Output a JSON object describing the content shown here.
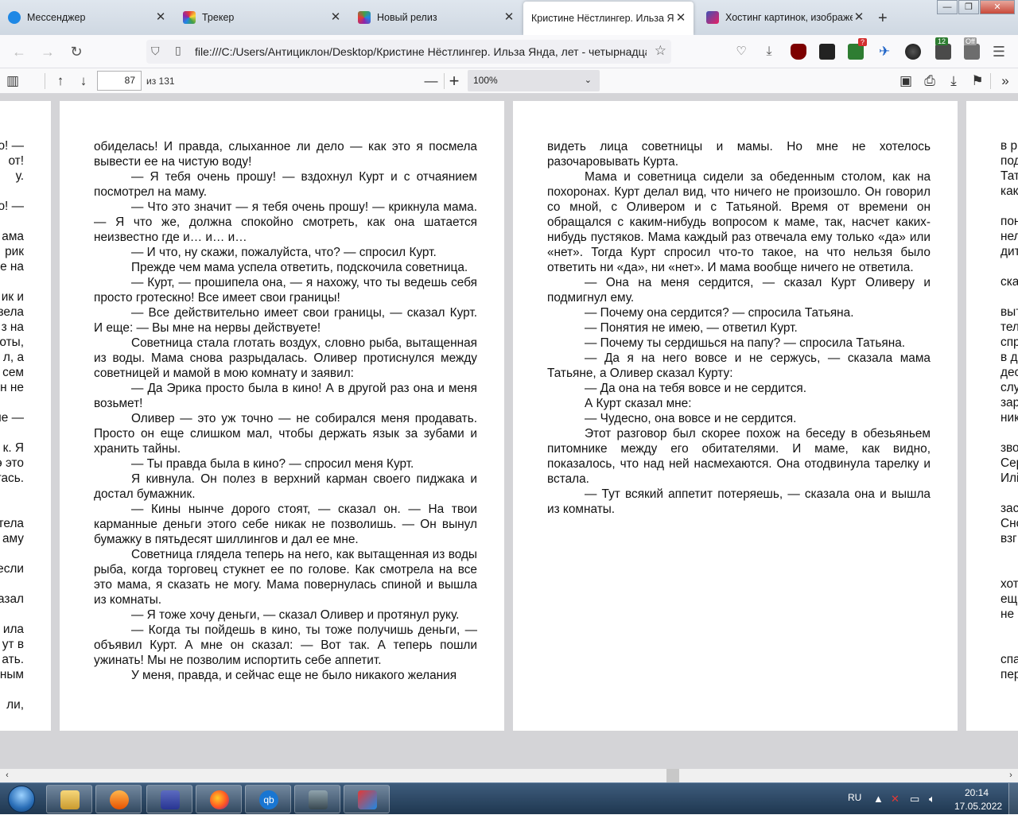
{
  "tabs": [
    {
      "label": "Мессенджер",
      "color": "#1e88e5",
      "active": false
    },
    {
      "label": "Трекер",
      "color": "#c2185b",
      "active": false
    },
    {
      "label": "Новый релиз",
      "color": "#8e24aa",
      "active": false
    },
    {
      "label": "Кристине Нёстлингер. Ильза Янда",
      "color": "",
      "active": true
    },
    {
      "label": "Хостинг картинок, изображе",
      "color": "#3f51b5",
      "active": false
    }
  ],
  "nav": {
    "url": "file:///C:/Users/Антициклон/Desktop/Кристине Нёстлингер. Ильза Янда, лет - четырнадцать"
  },
  "extensions": {
    "badge_1": "?",
    "badge_2": "12",
    "badge_3": "Off"
  },
  "pdf_toolbar": {
    "page_number": "87",
    "page_total": "из 131",
    "zoom": "100%"
  },
  "left_edge_lines": [
    "о! —",
    "от!",
    "у.",
    "",
    "о! —",
    "",
    "ама",
    "рик",
    "е на",
    "",
    "ик и",
    "зела",
    "з на",
    "оты,",
    "л, а",
    "сем",
    "н не",
    "",
    "не —",
    "",
    "к. Я",
    "э это",
    "тась.",
    "",
    "",
    "тела",
    "аму",
    "",
    "если",
    "",
    "азал",
    "",
    "ила",
    "ут в",
    "ать.",
    "ным",
    "",
    "ли,"
  ],
  "page_left": [
    {
      "indent": false,
      "text": "обиделась! И правда, слыханное ли дело — как это я посмела вывести ее на чистую воду!"
    },
    {
      "indent": true,
      "text": "— Я тебя очень прошу! — вздохнул Курт и с отчаянием посмотрел на маму."
    },
    {
      "indent": true,
      "text": "— Что это значит — я тебя очень прошу! — крикнула мама. — Я что же, должна спокойно смотреть, как она шатается неизвестно где и… и… и…"
    },
    {
      "indent": true,
      "text": "— И что, ну скажи, пожалуйста, что? — спросил Курт."
    },
    {
      "indent": true,
      "text": "Прежде чем мама успела ответить, подскочила советница."
    },
    {
      "indent": true,
      "text": "— Курт, — прошипела она, — я нахожу, что ты ведешь себя просто гротескно! Все имеет свои границы!"
    },
    {
      "indent": true,
      "text": "— Все действительно имеет свои границы, — сказал Курт. И еще: — Вы мне на нервы действуете!"
    },
    {
      "indent": true,
      "text": "Советница стала глотать воздух, словно рыба, вытащенная из воды. Мама снова разрыдалась. Оливер протиснулся между советницей и мамой в мою комнату и заявил:"
    },
    {
      "indent": true,
      "text": "— Да Эрика просто была в кино! А в другой раз она и меня возьмет!"
    },
    {
      "indent": true,
      "text": "Оливер — это уж точно — не собирался меня продавать. Просто он еще слишком мал, чтобы держать язык за зубами и хранить тайны."
    },
    {
      "indent": true,
      "text": "— Ты правда была в кино? — спросил меня Курт."
    },
    {
      "indent": true,
      "text": "Я кивнула. Он полез в верхний карман своего пиджака и достал бумажник."
    },
    {
      "indent": true,
      "text": "— Кины нынче дорого стоят, — сказал он. — На твои карманные деньги этого себе никак не позволишь. — Он вынул бумажку в пятьдесят шиллингов и дал ее мне."
    },
    {
      "indent": true,
      "text": "Советница глядела теперь на него, как вытащенная из воды рыба, когда торговец стукнет ее по голове. Как смотрела на все это мама, я сказать не могу. Мама повернулась спиной и вышла из комнаты."
    },
    {
      "indent": true,
      "text": "— Я тоже хочу деньги, — сказал Оливер и протянул руку."
    },
    {
      "indent": true,
      "text": "— Когда ты пойдешь в кино, ты тоже получишь деньги, — объявил Курт. А мне он сказал: — Вот так. А теперь пошли ужинать! Мы не позволим испортить себе аппетит."
    },
    {
      "indent": true,
      "text": "У меня, правда, и сейчас еще не было никакого желания"
    }
  ],
  "page_right": [
    {
      "indent": false,
      "text": "видеть лица советницы и мамы. Но мне не хотелось разочаровывать Курта."
    },
    {
      "indent": true,
      "text": "Мама и советница сидели за обеденным столом, как на похоронах. Курт делал вид, что ничего не произошло. Он говорил со мной, с Оливером и с Татьяной. Время от времени он обращался с каким-нибудь вопросом к маме, так, насчет каких-нибудь пустяков. Мама каждый раз отвечала ему только «да» или «нет». Тогда Курт спросил что-то такое, на что нельзя было ответить ни «да», ни «нет». И мама вообще ничего не ответила."
    },
    {
      "indent": true,
      "text": "— Она на меня сердится, — сказал Курт Оливеру и подмигнул ему."
    },
    {
      "indent": true,
      "text": "— Почему она сердится? — спросила Татьяна."
    },
    {
      "indent": true,
      "text": "— Понятия не имею, — ответил Курт."
    },
    {
      "indent": true,
      "text": "— Почему ты сердишься на папу? — спросила Татьяна."
    },
    {
      "indent": true,
      "text": "— Да я на него вовсе и не сержусь, — сказала мама Татьяне, а Оливер сказал Курту:"
    },
    {
      "indent": true,
      "text": "— Да она на тебя вовсе и не сердится."
    },
    {
      "indent": true,
      "text": "А Курт сказал мне:"
    },
    {
      "indent": true,
      "text": "— Чудесно, она вовсе и не сердится."
    },
    {
      "indent": true,
      "text": "Этот разговор был скорее похож на беседу в обезьяньем питомнике между его обитателями. И маме, как видно, показалось, что над ней насмехаются. Она отодвинула тарелку и встала."
    },
    {
      "indent": true,
      "text": "— Тут всякий аппетит потеряешь, — сказала она и вышла из комнаты."
    }
  ],
  "right_edge_lines": [
    "в р",
    "под",
    "Тат",
    "как",
    "",
    "пон",
    "нел",
    "дит",
    "",
    "ска",
    "",
    "выт",
    "тел",
    "спр",
    "в д",
    "дес",
    "слу",
    "зар",
    "ник",
    "",
    "зво",
    "Сер",
    "Илі",
    "",
    "зас",
    "Сно",
    "взг",
    "",
    "",
    "хот",
    "ещ",
    "не",
    "",
    "",
    "спа",
    "пер"
  ],
  "taskbar": {
    "lang": "RU",
    "time": "20:14",
    "date": "17.05.2022"
  }
}
